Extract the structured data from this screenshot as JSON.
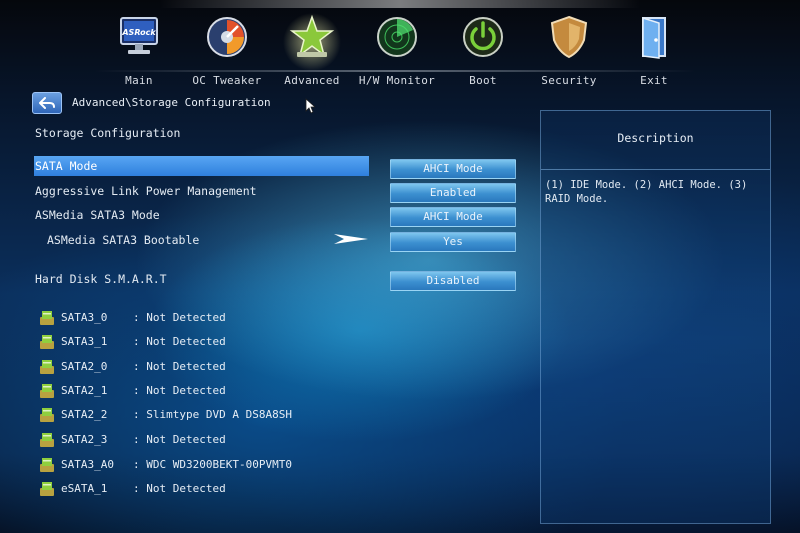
{
  "tabs": [
    {
      "label": "Main",
      "icon": "asrock-monitor-icon"
    },
    {
      "label": "OC Tweaker",
      "icon": "oc-gauge-icon"
    },
    {
      "label": "Advanced",
      "icon": "star-icon",
      "active": true
    },
    {
      "label": "H/W Monitor",
      "icon": "radar-icon"
    },
    {
      "label": "Boot",
      "icon": "power-icon"
    },
    {
      "label": "Security",
      "icon": "shield-icon"
    },
    {
      "label": "Exit",
      "icon": "door-icon"
    }
  ],
  "logo_text": "ASRock",
  "breadcrumb": "Advanced\\Storage Configuration",
  "section_title": "Storage Configuration",
  "settings": [
    {
      "label": "SATA Mode",
      "value": "AHCI Mode",
      "selected": true
    },
    {
      "label": "Aggressive Link Power Management",
      "value": "Enabled"
    },
    {
      "label": "ASMedia SATA3 Mode",
      "value": "AHCI Mode"
    },
    {
      "label": "ASMedia SATA3 Bootable",
      "value": "Yes"
    },
    {
      "label": "Hard Disk S.M.A.R.T",
      "value": "Disabled"
    }
  ],
  "devices": [
    {
      "port": "SATA3_0",
      "status": ": Not Detected"
    },
    {
      "port": "SATA3_1",
      "status": ": Not Detected"
    },
    {
      "port": "SATA2_0",
      "status": ": Not Detected"
    },
    {
      "port": "SATA2_1",
      "status": ": Not Detected"
    },
    {
      "port": "SATA2_2",
      "status": ": Slimtype DVD A  DS8A8SH"
    },
    {
      "port": "SATA2_3",
      "status": ": Not Detected"
    },
    {
      "port": "SATA3_A0",
      "status": ": WDC WD3200BEKT-00PVMT0"
    },
    {
      "port": "eSATA_1",
      "status": ": Not Detected"
    }
  ],
  "description": {
    "title": "Description",
    "text": "(1) IDE Mode. (2) AHCI Mode. (3) RAID Mode."
  },
  "colors": {
    "selection": "#3f8fe6",
    "option_button": "#4a9ad6",
    "background": "#0b2f5c"
  }
}
